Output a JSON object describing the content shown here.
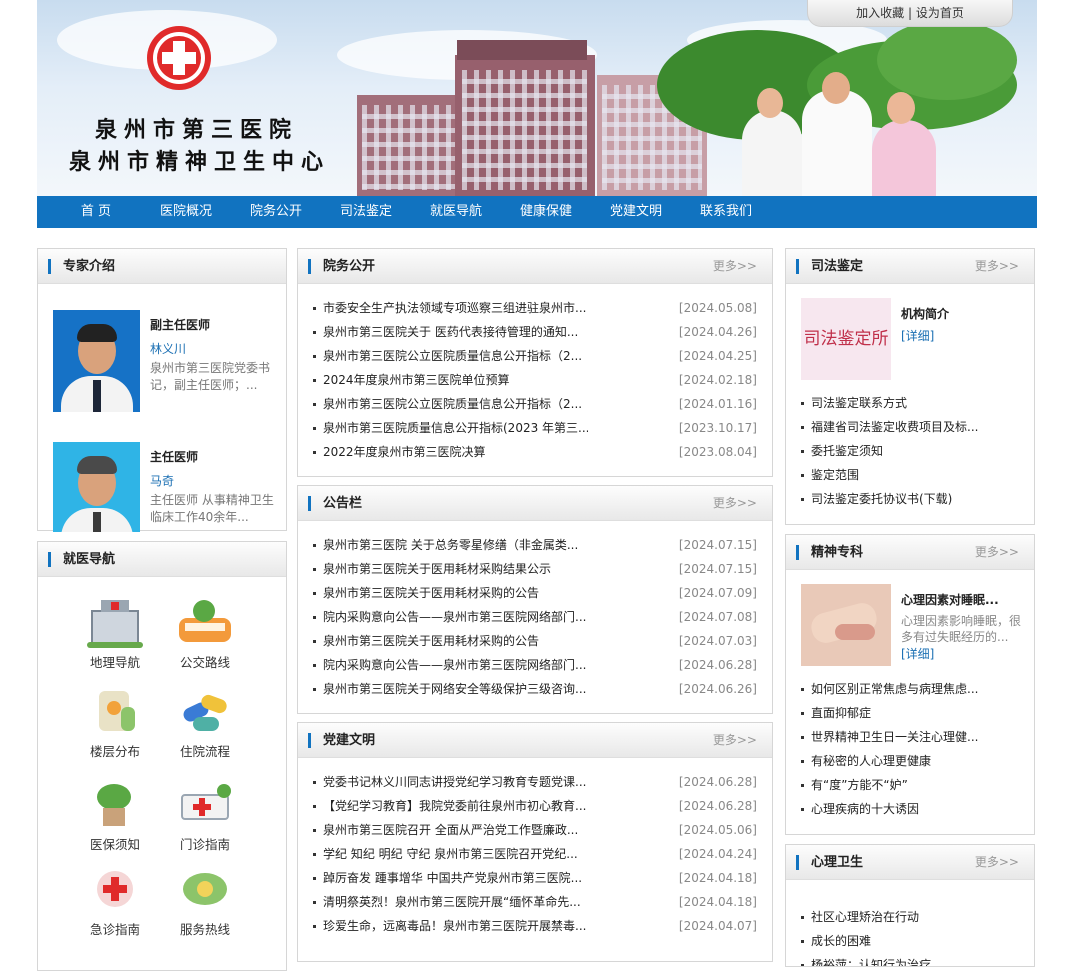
{
  "header": {
    "toplinks": {
      "favorite": "加入收藏",
      "sep": "|",
      "homepage": "设为首页"
    },
    "name_line1": "泉州市第三医院",
    "name_line2": "泉州市精神卫生中心"
  },
  "nav": [
    "首 页",
    "医院概况",
    "院务公开",
    "司法鉴定",
    "就医导航",
    "健康保健",
    "党建文明",
    "联系我们"
  ],
  "experts": {
    "title": "专家介绍",
    "items": [
      {
        "role": "副主任医师",
        "name": "林义川",
        "desc": "泉州市第三医院党委书记，副主任医师；..."
      },
      {
        "role": "主任医师",
        "name": "马奇",
        "desc": "主任医师 从事精神卫生临床工作40余年..."
      }
    ]
  },
  "guide": {
    "title": "就医导航",
    "items": [
      "地理导航",
      "公交路线",
      "楼层分布",
      "住院流程",
      "医保须知",
      "门诊指南",
      "急诊指南",
      "服务热线"
    ]
  },
  "affairs": {
    "title": "院务公开",
    "more": "更多>>",
    "items": [
      {
        "t": "市委安全生产执法领域专项巡察三组进驻泉州市...",
        "d": "[2024.05.08]"
      },
      {
        "t": "泉州市第三医院关于 医药代表接待管理的通知...",
        "d": "[2024.04.26]"
      },
      {
        "t": "泉州市第三医院公立医院质量信息公开指标（2...",
        "d": "[2024.04.25]"
      },
      {
        "t": "2024年度泉州市第三医院单位预算",
        "d": "[2024.02.18]"
      },
      {
        "t": "泉州市第三医院公立医院质量信息公开指标（2...",
        "d": "[2024.01.16]"
      },
      {
        "t": "泉州市第三医院质量信息公开指标(2023 年第三...",
        "d": "[2023.10.17]"
      },
      {
        "t": "2022年度泉州市第三医院决算",
        "d": "[2023.08.04]"
      }
    ]
  },
  "notices": {
    "title": "公告栏",
    "more": "更多>>",
    "items": [
      {
        "t": "泉州市第三医院 关于总务零星修缮（非金属类...",
        "d": "[2024.07.15]"
      },
      {
        "t": "泉州市第三医院关于医用耗材采购结果公示",
        "d": "[2024.07.15]"
      },
      {
        "t": "泉州市第三医院关于医用耗材采购的公告",
        "d": "[2024.07.09]"
      },
      {
        "t": "院内采购意向公告——泉州市第三医院网络部门...",
        "d": "[2024.07.08]"
      },
      {
        "t": "泉州市第三医院关于医用耗材采购的公告",
        "d": "[2024.07.03]"
      },
      {
        "t": "院内采购意向公告——泉州市第三医院网络部门...",
        "d": "[2024.06.28]"
      },
      {
        "t": "泉州市第三医院关于网络安全等级保护三级咨询...",
        "d": "[2024.06.26]"
      }
    ]
  },
  "party": {
    "title": "党建文明",
    "more": "更多>>",
    "items": [
      {
        "t": "党委书记林义川同志讲授党纪学习教育专题党课...",
        "d": "[2024.06.28]"
      },
      {
        "t": "【党纪学习教育】我院党委前往泉州市初心教育...",
        "d": "[2024.06.28]"
      },
      {
        "t": "泉州市第三医院召开 全面从严治党工作暨廉政...",
        "d": "[2024.05.06]"
      },
      {
        "t": "学纪 知纪 明纪 守纪 泉州市第三医院召开党纪...",
        "d": "[2024.04.24]"
      },
      {
        "t": "踔厉奋发 踵事增华 中国共产党泉州市第三医院...",
        "d": "[2024.04.18]"
      },
      {
        "t": "清明祭英烈！泉州市第三医院开展“缅怀革命先...",
        "d": "[2024.04.18]"
      },
      {
        "t": "珍爱生命，远离毒品！泉州市第三医院开展禁毒...",
        "d": "[2024.04.07]"
      }
    ]
  },
  "forensic": {
    "title": "司法鉴定",
    "more": "更多>>",
    "thumb_text": "司法鉴定所",
    "feat_title": "机构简介",
    "feat_link": "[详细]",
    "items": [
      "司法鉴定联系方式",
      "福建省司法鉴定收费项目及标...",
      "委托鉴定须知",
      "鉴定范围",
      "司法鉴定委托协议书(下载)"
    ]
  },
  "psych": {
    "title": "精神专科",
    "more": "更多>>",
    "feat_title": "心理因素对睡眠...",
    "feat_desc": "心理因素影响睡眠，很多有过失眠经历的...",
    "feat_link": "[详细]",
    "items": [
      "如何区别正常焦虑与病理焦虑...",
      "直面抑郁症",
      "世界精神卫生日一关注心理健...",
      "有秘密的人心理更健康",
      "有“度”方能不“妒”",
      "心理疾病的十大诱因"
    ]
  },
  "mental": {
    "title": "心理卫生",
    "more": "更多>>",
    "items": [
      "社区心理矫治在行动",
      "成长的困难",
      "杨裕萍：认知行为治疗..."
    ]
  }
}
